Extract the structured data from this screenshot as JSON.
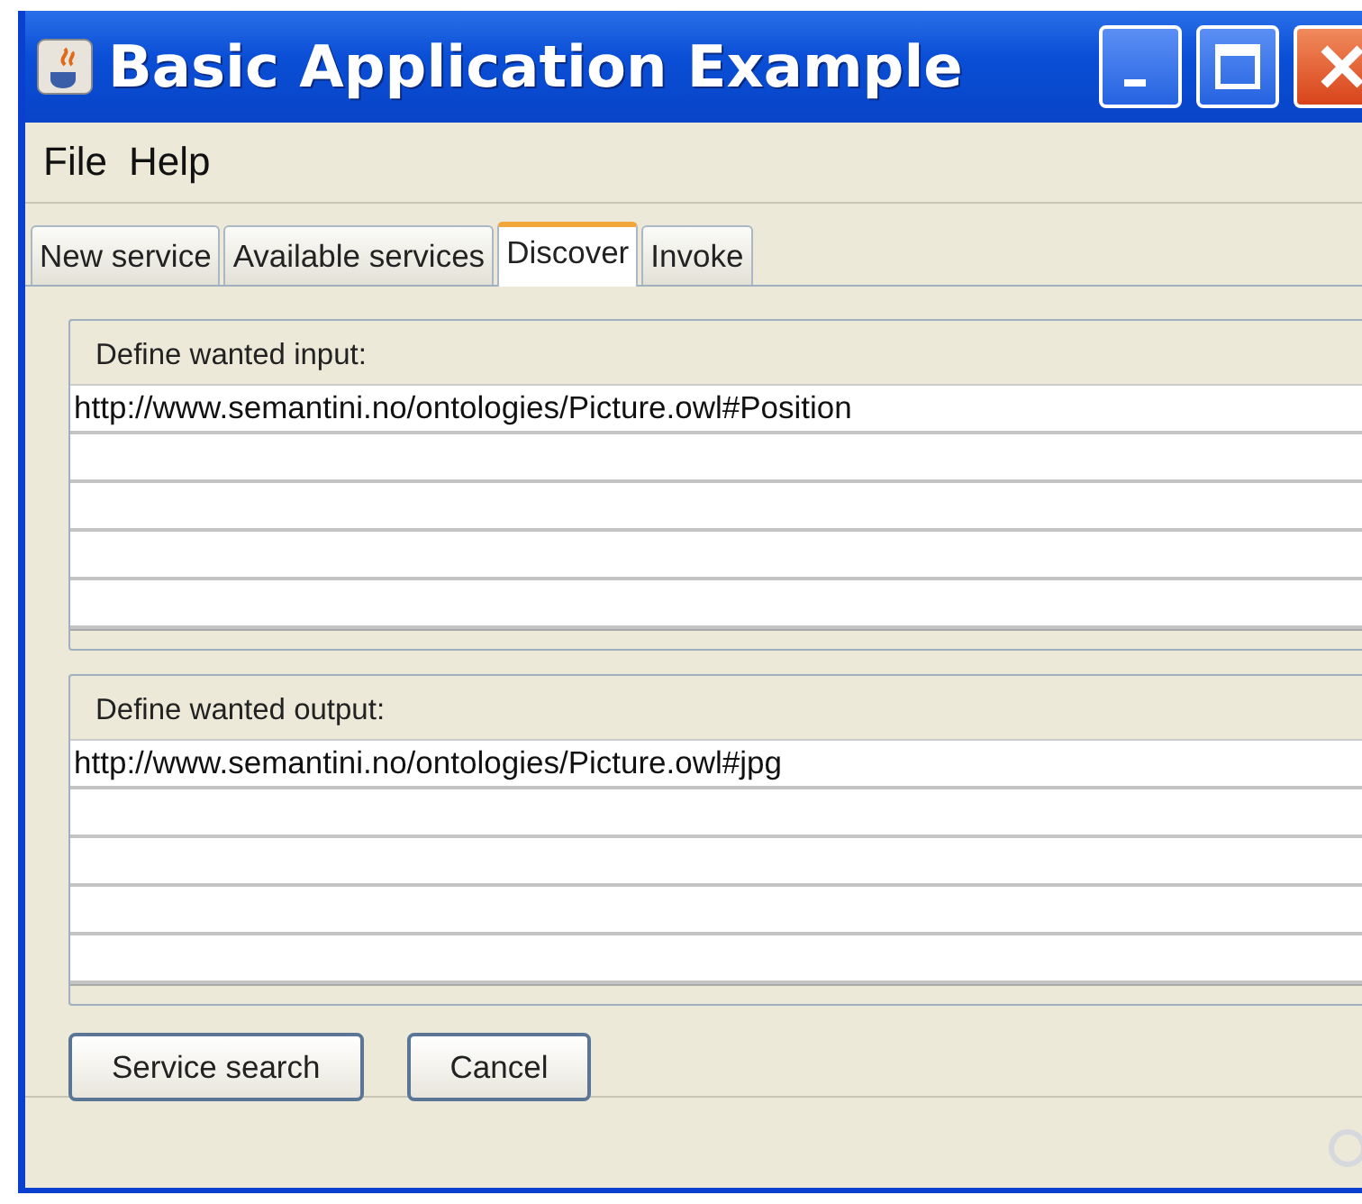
{
  "window": {
    "title": "Basic Application Example"
  },
  "menu": [
    {
      "label": "File"
    },
    {
      "label": "Help"
    }
  ],
  "tabs": [
    {
      "label": "New service",
      "selected": false
    },
    {
      "label": "Available services",
      "selected": false
    },
    {
      "label": "Discover",
      "selected": true
    },
    {
      "label": "Invoke",
      "selected": false
    }
  ],
  "groups": [
    {
      "label": "Define wanted input:",
      "rows": [
        "http://www.semantini.no/ontologies/Picture.owl#Position"
      ]
    },
    {
      "label": "Define wanted output:",
      "rows": [
        "http://www.semantini.no/ontologies/Picture.owl#jpg"
      ]
    }
  ],
  "buttons": [
    {
      "label": "Service search"
    },
    {
      "label": "Cancel"
    }
  ]
}
